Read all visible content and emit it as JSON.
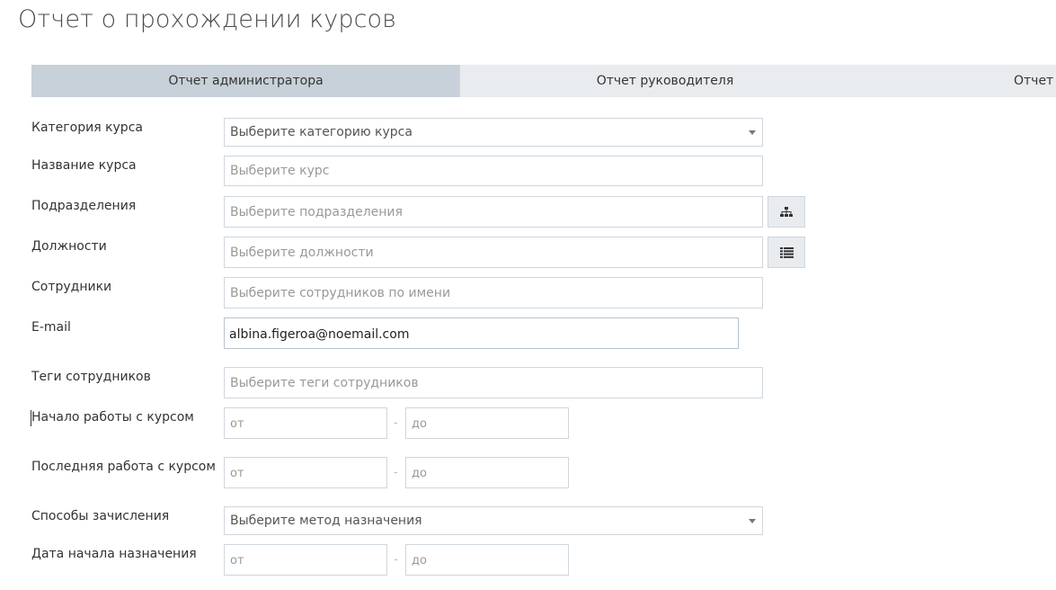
{
  "page": {
    "title": "Отчет о прохождении курсов"
  },
  "tabs": [
    {
      "label": "Отчет администратора",
      "active": true
    },
    {
      "label": "Отчет руководителя",
      "active": false
    },
    {
      "label": "Отчет с",
      "active": false
    }
  ],
  "form": {
    "course_category": {
      "label": "Категория курса",
      "placeholder": "Выберите категорию курса"
    },
    "course_name": {
      "label": "Название курса",
      "placeholder": "Выберите курс"
    },
    "departments": {
      "label": "Подразделения",
      "placeholder": "Выберите подразделения",
      "button_icon": "org-chart-icon"
    },
    "positions": {
      "label": "Должности",
      "placeholder": "Выберите должности",
      "button_icon": "list-icon"
    },
    "employees": {
      "label": "Сотрудники",
      "placeholder": "Выберите сотрудников по имени"
    },
    "email": {
      "label": "E-mail",
      "value": "albina.figeroa@noemail.com"
    },
    "employee_tags": {
      "label": "Теги сотрудников",
      "placeholder": "Выберите теги сотрудников"
    },
    "course_start": {
      "label": "Начало работы с курсом",
      "from_placeholder": "от",
      "to_placeholder": "до",
      "separator": "-"
    },
    "last_work": {
      "label": "Последняя работа с курсом",
      "from_placeholder": "от",
      "to_placeholder": "до",
      "separator": "-"
    },
    "enrollment_methods": {
      "label": "Способы зачисления",
      "placeholder": "Выберите метод назначения"
    },
    "assignment_start": {
      "label": "Дата начала назначения",
      "from_placeholder": "от",
      "to_placeholder": "до",
      "separator": "-"
    }
  }
}
